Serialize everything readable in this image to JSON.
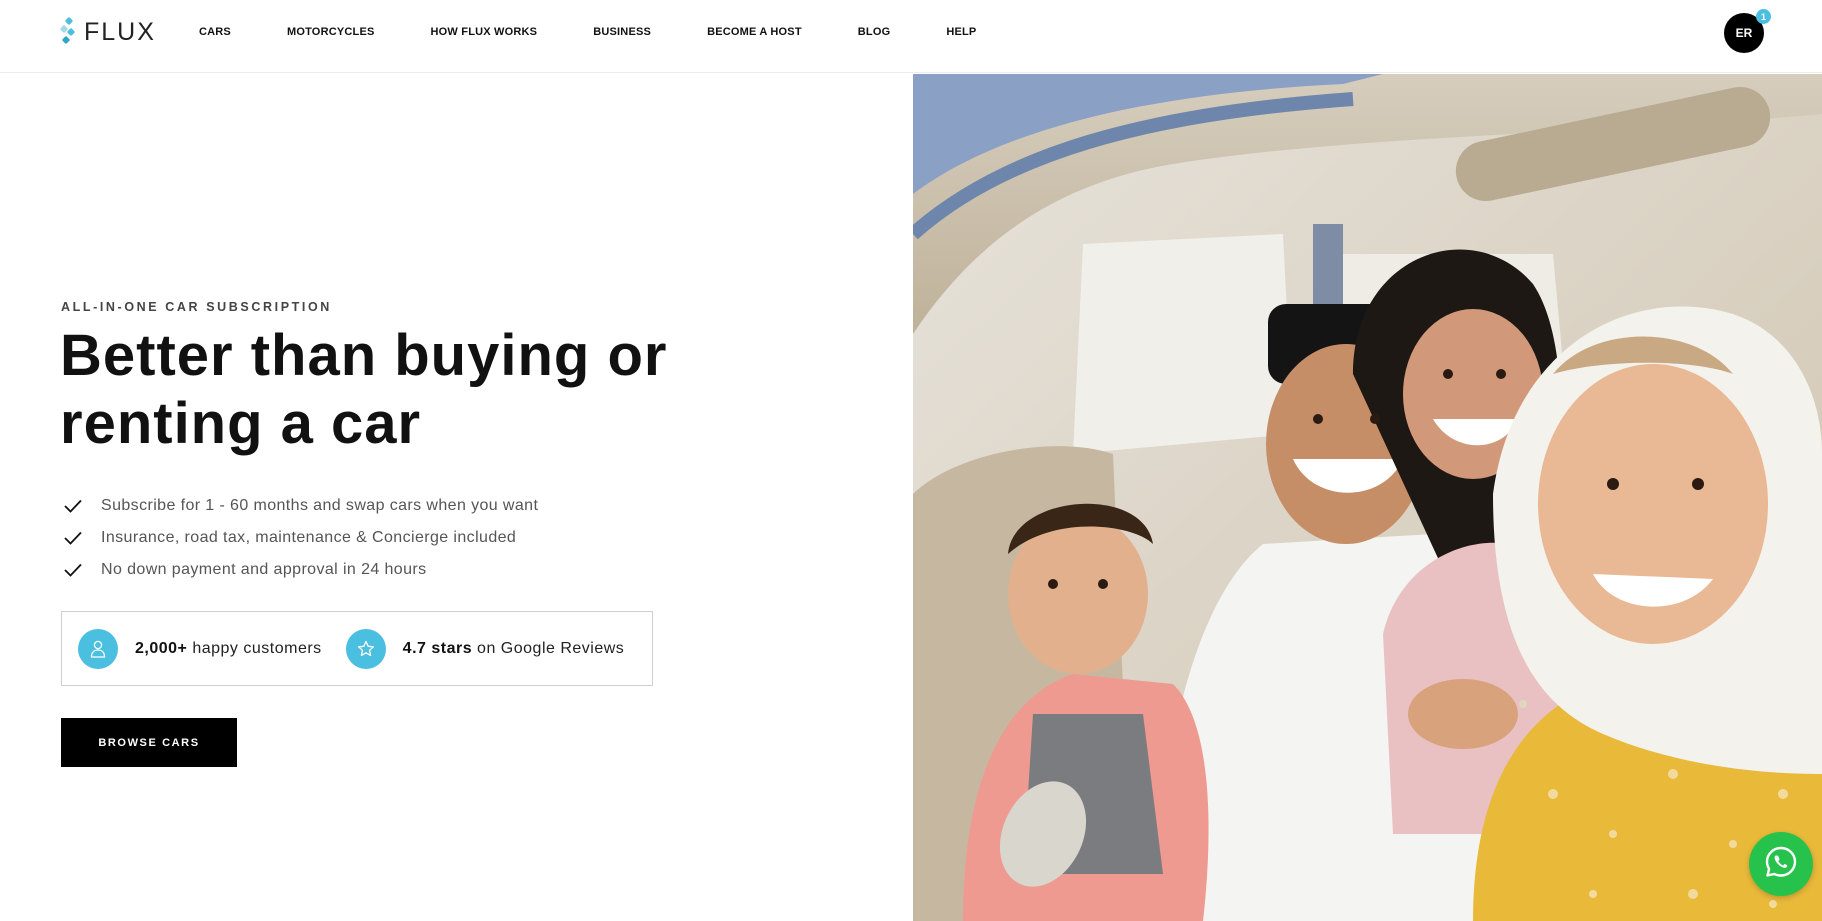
{
  "header": {
    "logo_text": "FLUX",
    "nav": [
      {
        "label": "CARS"
      },
      {
        "label": "MOTORCYCLES"
      },
      {
        "label": "HOW FLUX WORKS"
      },
      {
        "label": "BUSINESS"
      },
      {
        "label": "BECOME A HOST"
      },
      {
        "label": "BLOG"
      },
      {
        "label": "HELP"
      }
    ],
    "avatar_initials": "ER",
    "notification_count": "1"
  },
  "hero": {
    "eyebrow": "ALL-IN-ONE CAR SUBSCRIPTION",
    "headline_line1": "Better than buying or",
    "headline_line2": "renting a car",
    "features": [
      {
        "text": "Subscribe for 1 - 60 months and swap cars when you want"
      },
      {
        "text": "Insurance, road tax, maintenance & Concierge included"
      },
      {
        "text": "No down payment and approval in 24 hours"
      }
    ],
    "stats": {
      "customers_value": "2,000+",
      "customers_label": " happy customers",
      "rating_value": "4.7 stars",
      "rating_label": " on Google Reviews"
    },
    "cta_label": "BROWSE CARS"
  },
  "icons": {
    "logo": "flux-logo-icon",
    "check": "check-icon",
    "user": "user-icon",
    "star": "star-icon",
    "whatsapp": "whatsapp-icon"
  },
  "colors": {
    "accent": "#4bbfdf",
    "primary_button": "#000000",
    "whatsapp": "#27c24c"
  }
}
